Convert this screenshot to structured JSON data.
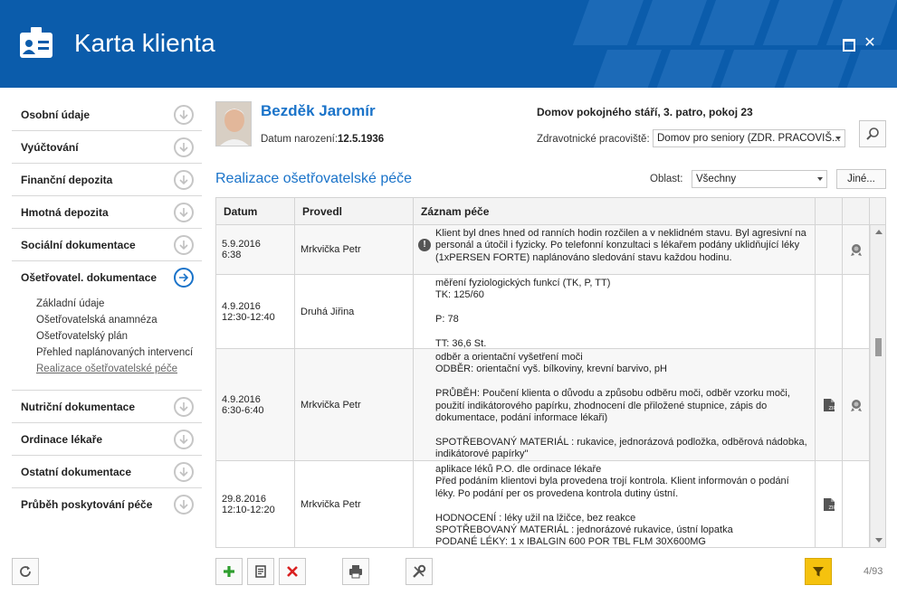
{
  "window": {
    "title": "Karta klienta"
  },
  "sidebar": {
    "items": [
      {
        "label": "Osobní údaje"
      },
      {
        "label": "Vyúčtování"
      },
      {
        "label": "Finanční depozita"
      },
      {
        "label": "Hmotná depozita"
      },
      {
        "label": "Sociální dokumentace"
      },
      {
        "label": "Ošetřovatel. dokumentace",
        "active": true
      },
      {
        "label": "Nutriční dokumentace"
      },
      {
        "label": "Ordinace lékaře"
      },
      {
        "label": "Ostatní dokumentace"
      },
      {
        "label": "Průběh poskytování péče"
      }
    ],
    "subitems": [
      "Základní údaje",
      "Ošetřovatelská anamnéza",
      "Ošetřovatelský plán",
      "Přehled naplánovaných intervencí",
      "Realizace ošetřovatelské péče"
    ]
  },
  "client": {
    "name": "Bezděk Jaromír",
    "dob_label": "Datum narození:",
    "dob": "12.5.1936",
    "facility": "Domov pokojného stáří, 3. patro, pokoj 23",
    "workplace_label": "Zdravotnické pracoviště:",
    "workplace": "Domov pro seniory (ZDR. PRACOVIŠ..."
  },
  "section": {
    "title": "Realizace ošetřovatelské péče",
    "area_label": "Oblast:",
    "area_value": "Všechny",
    "other_button": "Jiné..."
  },
  "table": {
    "headers": {
      "date": "Datum",
      "by": "Provedl",
      "record": "Záznam péče"
    },
    "rows": [
      {
        "date": "5.9.2016\n6:38",
        "by": "Mrkvička Petr",
        "record": "Klient byl dnes hned od ranních hodin rozčilen a v neklidném stavu. Byl agresivní na personál a útočil i fyzicky. Po telefonní konzultaci s lékařem podány uklidňující léky (1xPERSEN FORTE) naplánováno sledování stavu každou hodinu.",
        "warning": true,
        "attachment": false,
        "badge": true
      },
      {
        "date": "4.9.2016\n12:30-12:40",
        "by": "Druhá Jiřina",
        "record": "měření fyziologických funkcí (TK, P, TT)\nTK: 125/60\n\nP: 78\n\nTT: 36,6 St.",
        "warning": false,
        "attachment": false,
        "badge": false
      },
      {
        "date": "4.9.2016\n6:30-6:40",
        "by": "Mrkvička Petr",
        "record": "odběr a orientační vyšetření moči\nODBĚR: orientační vyš. bílkoviny, krevní barvivo, pH\n\nPRŮBĚH: Poučení klienta o důvodu a způsobu odběru moči, odběr vzorku moči, použití indikátorového papírku, zhodnocení dle přiložené stupnice, zápis do dokumentace, podání informace lékaři)\n\nSPOTŘEBOVANÝ MATERIÁL : rukavice, jednorázová podložka, odběrová nádobka, indikátorové papírky\"",
        "warning": false,
        "attachment": true,
        "badge": true
      },
      {
        "date": "29.8.2016\n12:10-12:20",
        "by": "Mrkvička Petr",
        "record": "aplikace léků P.O. dle ordinace lékaře\nPřed podáním klientovi byla provedena trojí kontrola. Klient informován o podání léky. Po podání per os provedena kontrola dutiny ústní.\n\nHODNOCENÍ : léky užil na lžičce, bez reakce\nSPOTŘEBOVANÝ MATERIÁL : jednorázové rukavice, ústní lopatka\nPODANÉ LÉKY: 1 x IBALGIN 600 POR TBL FLM 30X600MG",
        "warning": false,
        "attachment": true,
        "badge": false
      }
    ]
  },
  "toolbar": {
    "counter": "4/93"
  },
  "colors": {
    "header": "#0b5cab",
    "accent": "#1a73c9",
    "filter": "#f5c20e",
    "add": "#2e9e2e",
    "delete": "#d92020"
  },
  "icons": [
    "id-card-icon",
    "maximize-icon",
    "close-icon",
    "chevron-down-icon",
    "arrow-right-icon",
    "refresh-icon",
    "search-icon",
    "warning-icon",
    "attachment-icon",
    "badge-icon",
    "add-icon",
    "edit-icon",
    "delete-icon",
    "print-icon",
    "tools-icon",
    "filter-icon"
  ]
}
